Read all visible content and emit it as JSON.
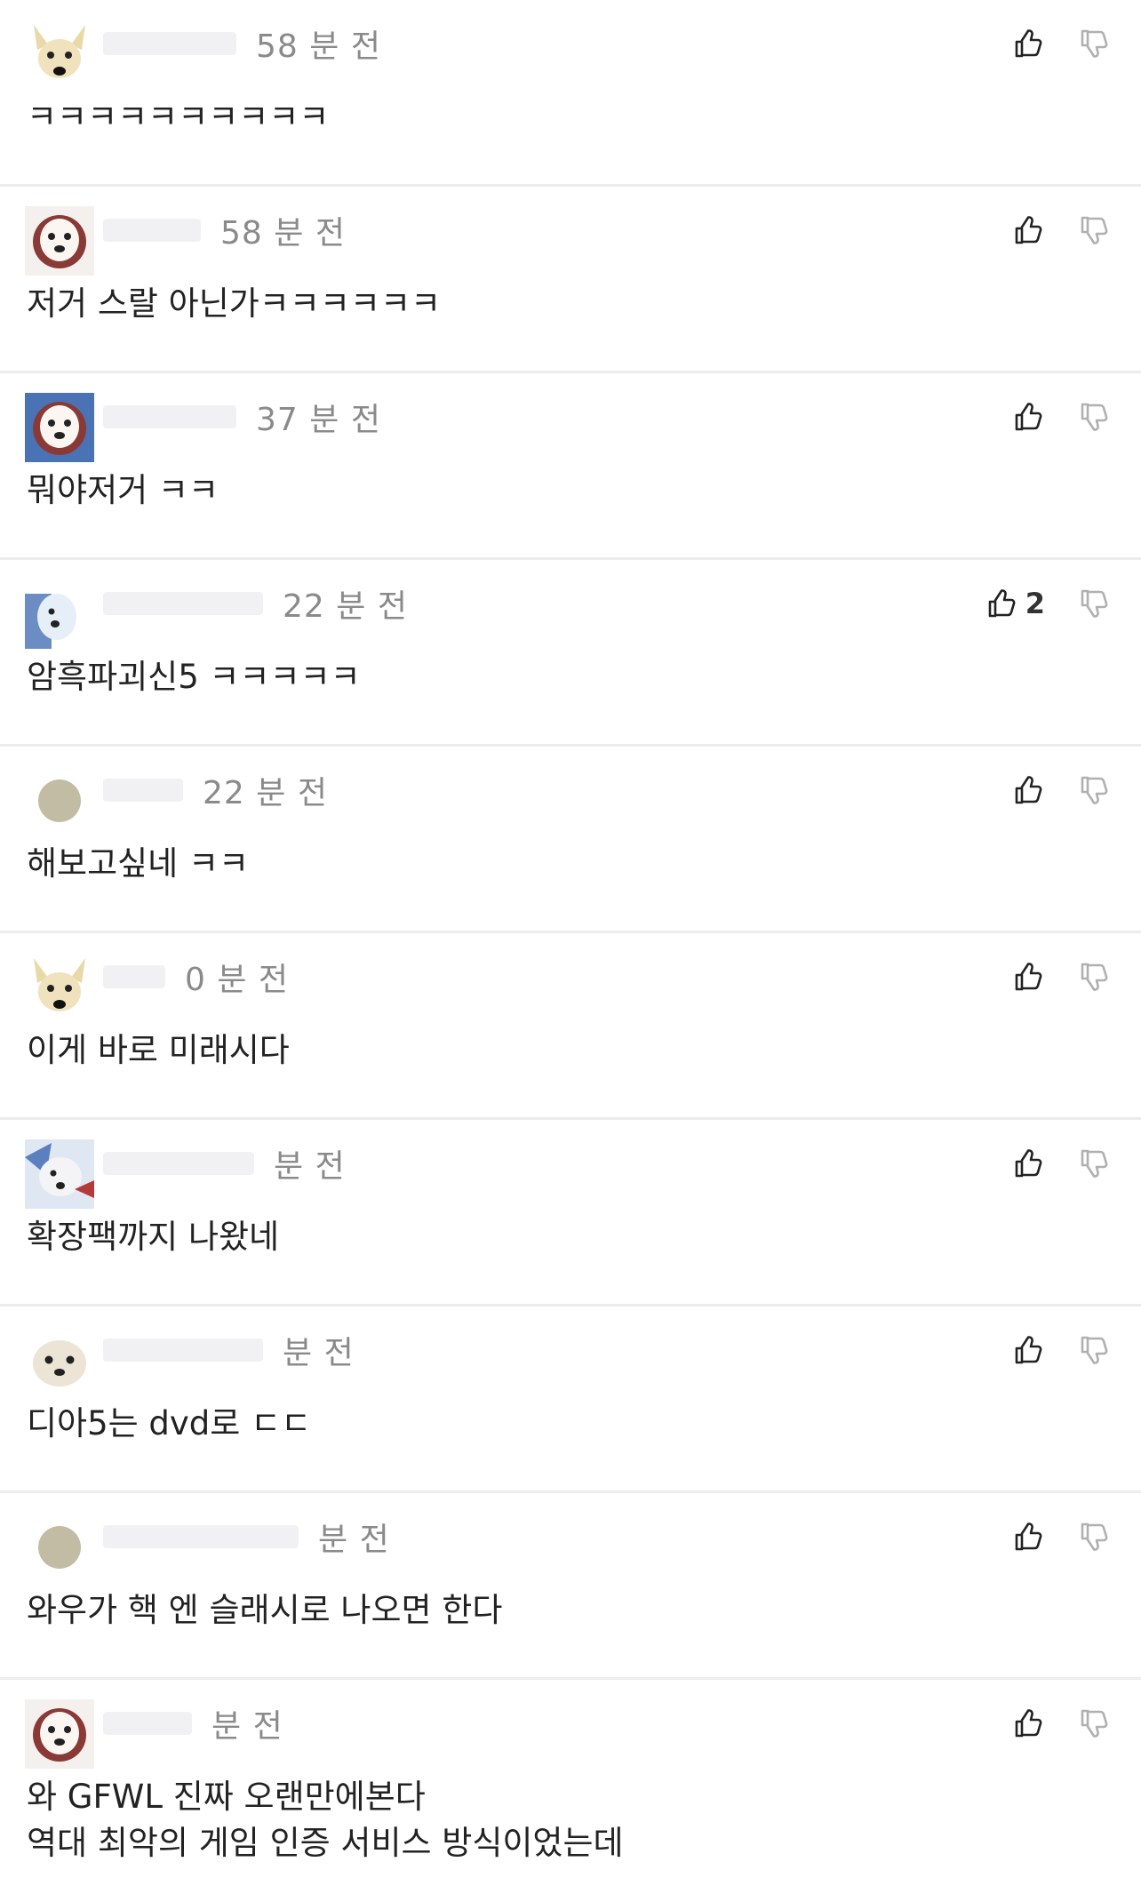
{
  "comments": [
    {
      "time": "58 분 전",
      "text": "ㅋㅋㅋㅋㅋㅋㅋㅋㅋㅋ",
      "up_count": "",
      "avatar": "dog-yellow"
    },
    {
      "time": "58 분 전",
      "text": "저거 스랄 아닌가ㅋㅋㅋㅋㅋㅋ",
      "up_count": "",
      "avatar": "dog-white-red"
    },
    {
      "time": "37 분 전",
      "text": "뭐야저거 ㅋㅋ",
      "up_count": "",
      "avatar": "dog-white-blue"
    },
    {
      "time": "22 분 전",
      "text": "암흑파괴신5 ㅋㅋㅋㅋㅋ",
      "up_count": "2",
      "avatar": "dog-blue"
    },
    {
      "time": "22 분 전",
      "text": "해보고싶네 ㅋㅋ",
      "up_count": "",
      "avatar": "circle-beige"
    },
    {
      "time": "0 분 전",
      "text": "이게 바로 미래시다",
      "up_count": "",
      "avatar": "dog-yellow"
    },
    {
      "time": "분 전",
      "text": "확장팩까지 나왔네",
      "up_count": "",
      "avatar": "dog-blue-red"
    },
    {
      "time": "분 전",
      "text": "디아5는 dvd로 ㄷㄷ",
      "up_count": "",
      "avatar": "dog-white-face"
    },
    {
      "time": "분 전",
      "text": "와우가 핵 엔 슬래시로 나오면 한다",
      "up_count": "",
      "avatar": "circle-beige"
    },
    {
      "time": "분 전",
      "text": "와 GFWL 진짜 오랜만에본다\n역대 최악의 게임 인증 서비스 방식이었는데",
      "up_count": "",
      "avatar": "dog-white-red"
    }
  ],
  "icons": {
    "upvote": "thumbs-up-icon",
    "downvote": "thumbs-down-icon"
  },
  "colors": {
    "text": "#222222",
    "time": "#8a8a8a",
    "divider": "#ececec",
    "vote_icon": "#222222",
    "downvote_icon": "#b0b0b0"
  }
}
